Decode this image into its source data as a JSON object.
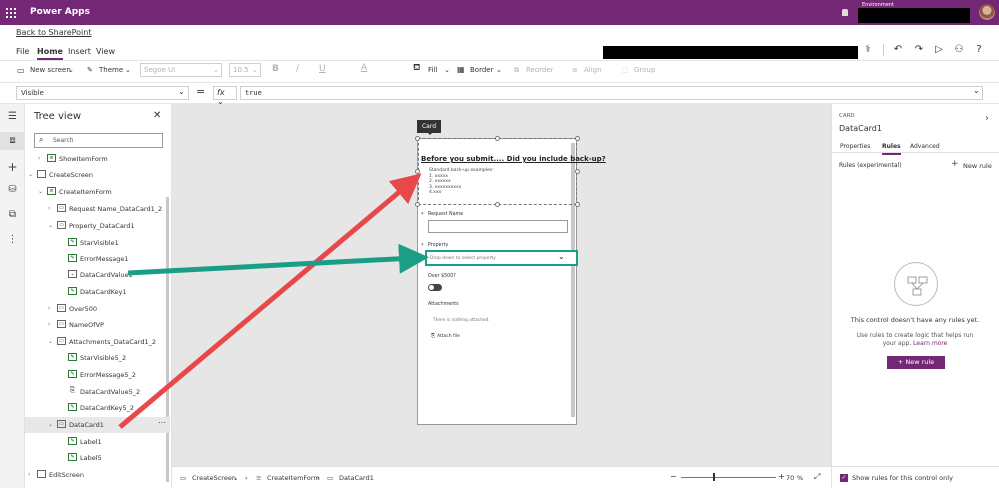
{
  "app": {
    "title": "Power Apps",
    "environment_label": "Environment"
  },
  "back_link": "Back to SharePoint",
  "menu": {
    "items": [
      "File",
      "Home",
      "Insert",
      "View"
    ]
  },
  "ribbon": {
    "new_screen": "New screen",
    "theme": "Theme",
    "font": "Segoe UI",
    "font_size": "10.5",
    "bold": "B",
    "italic": "/",
    "underline": "U",
    "font_color": "A",
    "fill": "Fill",
    "border": "Border",
    "reorder": "Reorder",
    "align": "Align",
    "group": "Group"
  },
  "formula_bar": {
    "property": "Visible",
    "equals": "=",
    "fx": "fx",
    "formula": "true"
  },
  "tree_view": {
    "title": "Tree view",
    "search_placeholder": "Search",
    "items": [
      {
        "label": "ShowItemForm"
      },
      {
        "label": "CreateScreen"
      },
      {
        "label": "CreateItemForm"
      },
      {
        "label": "Request Name_DataCard1_2"
      },
      {
        "label": "Property_DataCard1"
      },
      {
        "label": "StarVisible1"
      },
      {
        "label": "ErrorMessage1"
      },
      {
        "label": "DataCardValue1"
      },
      {
        "label": "DataCardKey1"
      },
      {
        "label": "Over500"
      },
      {
        "label": "NameOfVP"
      },
      {
        "label": "Attachments_DataCard1_2"
      },
      {
        "label": "StarVisible5_2"
      },
      {
        "label": "ErrorMessage5_2"
      },
      {
        "label": "DataCardValue5_2"
      },
      {
        "label": "DataCardKey5_2"
      },
      {
        "label": "DataCard1"
      },
      {
        "label": "Label1"
      },
      {
        "label": "Label5"
      },
      {
        "label": "EditScreen"
      }
    ]
  },
  "canvas": {
    "tooltip": "Card",
    "heading": "Before you submit.... Did you include back-up?",
    "subtext": "Standard back-up examples:\n1. xxxxx\n2. xxxxxx\n3. xxxxxxxxxx\n4.xxx",
    "request_name_label": "Request Name",
    "property_label": "Property",
    "property_placeholder": "Drop down to select property",
    "over_label": "Over $500?",
    "attachments_label": "Attachments",
    "no_attachments": "There is nothing attached.",
    "attach_file": "Attach file",
    "required_star": "*"
  },
  "right_panel": {
    "kind": "CARD",
    "name": "DataCard1",
    "tabs": [
      "Properties",
      "Rules",
      "Advanced"
    ],
    "rules_label": "Rules (experimental)",
    "new_rule": "New rule",
    "empty_title": "This control doesn't have any rules yet.",
    "empty_desc": "Use rules to create logic that helps run your app.",
    "learn_more": "Learn more",
    "show_rules": "Show rules for this control only"
  },
  "bottom_bar": {
    "crumbs": [
      "CreateScreen",
      "CreateItemForm",
      "DataCard1"
    ],
    "zoom": "70",
    "zoom_unit": "%",
    "minus": "−",
    "plus": "+"
  },
  "colors": {
    "brand": "#742774",
    "highlight": "#1a9f86",
    "arrow_red": "#e8484a",
    "arrow_teal": "#1a9f86"
  },
  "icons": [
    "waffle-icon",
    "undo-icon",
    "redo-icon",
    "play-icon",
    "user-icon",
    "help-icon",
    "stethoscope-icon"
  ]
}
